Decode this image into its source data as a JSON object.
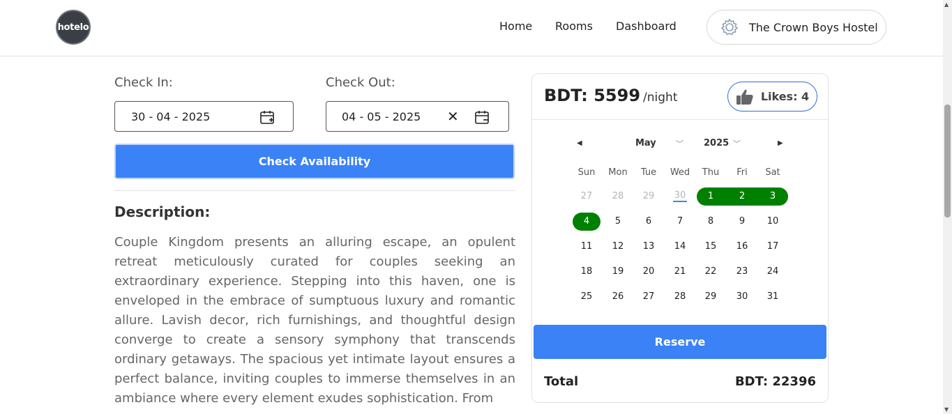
{
  "header": {
    "logo_text": "hotelo",
    "nav": [
      "Home",
      "Rooms",
      "Dashboard"
    ],
    "hostel_name": "The Crown Boys Hostel"
  },
  "booking": {
    "check_in_label": "Check In:",
    "check_out_label": "Check Out:",
    "check_in_value": "30 - 04 - 2025",
    "check_out_value": "04 - 05 - 2025",
    "check_button": "Check Availability"
  },
  "description": {
    "title": "Description:",
    "text": "Couple Kingdom presents an alluring escape, an opulent retreat meticulously curated for couples seeking an extraordinary experience. Stepping into this haven, one is enveloped in the embrace of sumptuous luxury and romantic allure. Lavish decor, rich furnishings, and thoughtful design converge to create a sensory symphony that transcends ordinary getaways. The spacious yet intimate layout ensures a perfect balance, inviting couples to immerse themselves in an ambiance where every element exudes sophistication. From"
  },
  "card": {
    "price": "BDT: 5599",
    "per": "/night",
    "likes": "Likes: 4",
    "month": "May",
    "year": "2025",
    "weekdays": [
      "Sun",
      "Mon",
      "Tue",
      "Wed",
      "Thu",
      "Fri",
      "Sat"
    ],
    "weeks": [
      [
        "27",
        "28",
        "29",
        "30",
        "1",
        "2",
        "3"
      ],
      [
        "4",
        "5",
        "6",
        "7",
        "8",
        "9",
        "10"
      ],
      [
        "11",
        "12",
        "13",
        "14",
        "15",
        "16",
        "17"
      ],
      [
        "18",
        "19",
        "20",
        "21",
        "22",
        "23",
        "24"
      ],
      [
        "25",
        "26",
        "27",
        "28",
        "29",
        "30",
        "31"
      ]
    ],
    "reserve": "Reserve",
    "total_label": "Total",
    "total_value": "BDT: 22396"
  },
  "colors": {
    "accent": "#3b82f6",
    "selected_range": "#008000"
  }
}
